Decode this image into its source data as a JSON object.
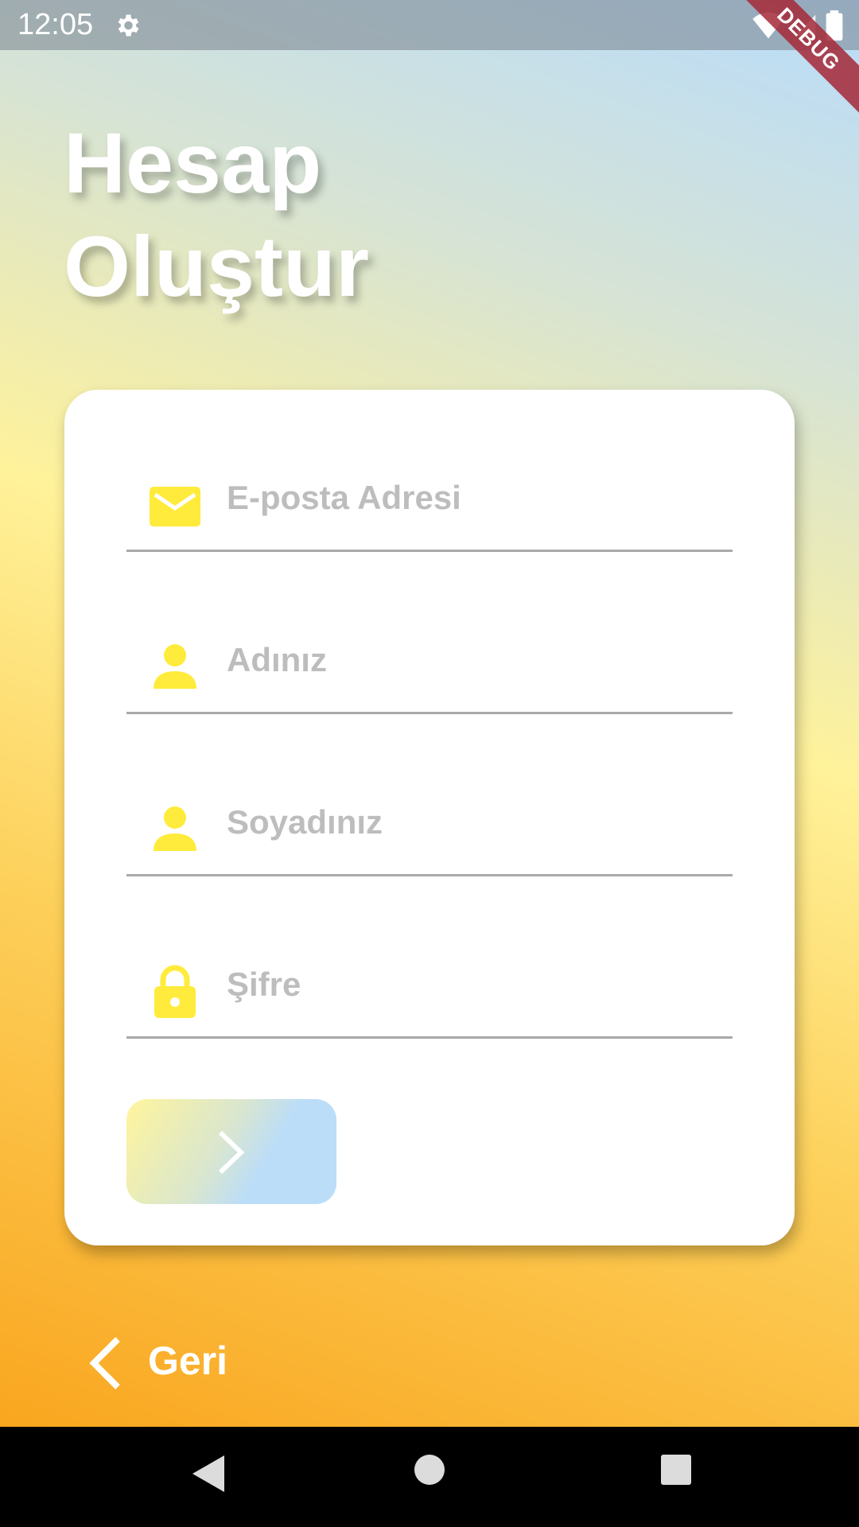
{
  "status_bar": {
    "time": "12:05",
    "debug_badge": "DEBUG",
    "icons": [
      "gear-icon",
      "wifi-icon",
      "cellular-icon",
      "battery-icon"
    ]
  },
  "title": {
    "line1": "Hesap",
    "line2": "Oluştur"
  },
  "form": {
    "email_placeholder": "E-posta Adresi",
    "first_name_placeholder": "Adınız",
    "last_name_placeholder": "Soyadınız",
    "password_placeholder": "Şifre"
  },
  "actions": {
    "back_label": "Geri"
  },
  "colors": {
    "accent_icon": "#ffeb3b",
    "placeholder_text": "#bdbdbd",
    "underline": "#a9a9a9"
  }
}
